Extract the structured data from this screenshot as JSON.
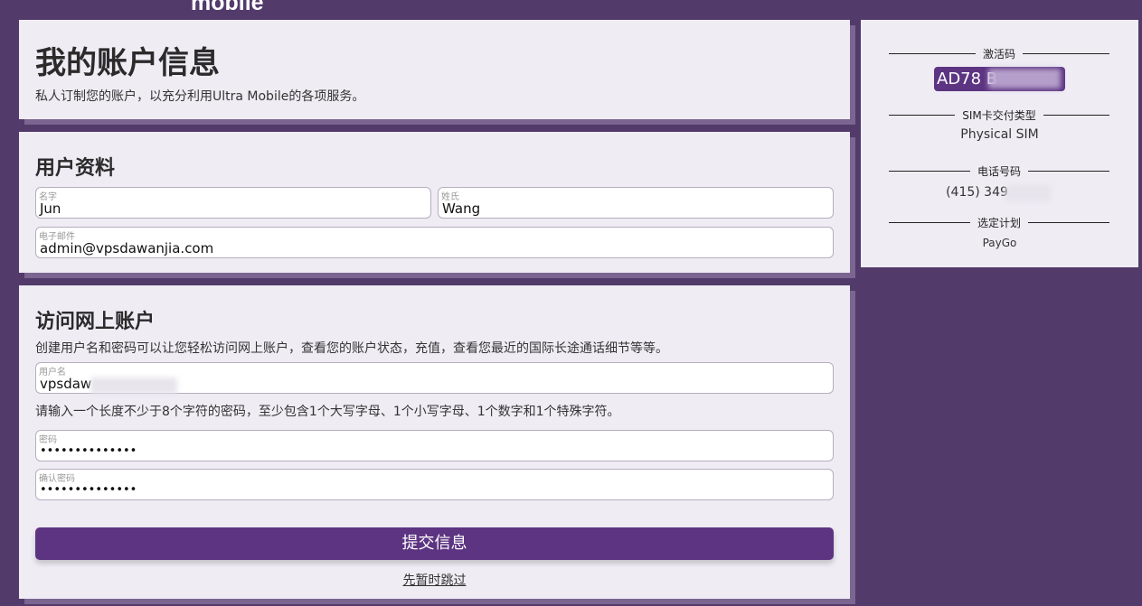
{
  "brand": {
    "logo_text": "mobile"
  },
  "account": {
    "title": "我的账户信息",
    "subtitle": "私人订制您的账户，以充分利用Ultra Mobile的各项服务。"
  },
  "profile": {
    "title": "用户资料",
    "first_name": {
      "label": "名字",
      "value": "Jun"
    },
    "last_name": {
      "label": "姓氏",
      "value": "Wang"
    },
    "email": {
      "label": "电子邮件",
      "value": "admin@vpsdawanjia.com"
    }
  },
  "online_access": {
    "title": "访问网上账户",
    "description": "创建用户名和密码可以让您轻松访问网上账户，查看您的账户状态，充值，查看您最近的国际长途通话细节等等。",
    "username": {
      "label": "用户名",
      "value": "vpsdaw"
    },
    "password_hint": "请输入一个长度不少于8个字符的密码，至少包含1个大写字母、1个小写字母、1个数字和1个特殊字符。",
    "password": {
      "label": "密码",
      "value": "••••••••••••••"
    },
    "confirm_password": {
      "label": "确认密码",
      "value": "••••••••••••••"
    },
    "submit_label": "提交信息",
    "skip_label": "先暂时跳过"
  },
  "summary": {
    "activation_code": {
      "label": "激活码",
      "value": "AD78 B"
    },
    "sim_type": {
      "label": "SIM卡交付类型",
      "value": "Physical SIM"
    },
    "phone": {
      "label": "电话号码",
      "value": "(415) 349"
    },
    "plan": {
      "label": "选定计划",
      "value": "PayGo"
    }
  },
  "colors": {
    "background": "#523a6a",
    "card": "#efecf4",
    "accent": "#5d3482"
  }
}
